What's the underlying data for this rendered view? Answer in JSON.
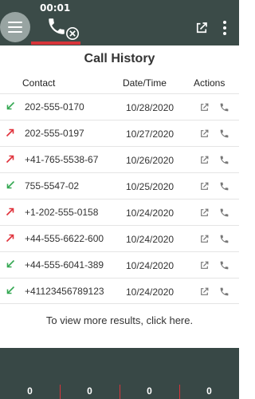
{
  "header": {
    "timer": "00:01",
    "colors": {
      "bar": "#3b4b48",
      "menu_circle": "#98a4a2",
      "active_underline": "#d8343a"
    }
  },
  "page": {
    "title": "Call History",
    "columns": {
      "contact": "Contact",
      "datetime": "Date/Time",
      "actions": "Actions"
    },
    "calls": [
      {
        "direction": "incoming",
        "number": "202-555-0170",
        "date": "10/28/2020"
      },
      {
        "direction": "outgoing",
        "number": "202-555-0197",
        "date": "10/27/2020"
      },
      {
        "direction": "outgoing",
        "number": "+41-765-5538-67",
        "date": "10/26/2020"
      },
      {
        "direction": "incoming",
        "number": "755-5547-02",
        "date": "10/25/2020"
      },
      {
        "direction": "outgoing",
        "number": "+1-202-555-0158",
        "date": "10/24/2020"
      },
      {
        "direction": "outgoing",
        "number": "+44-555-6622-600",
        "date": "10/24/2020"
      },
      {
        "direction": "incoming",
        "number": "+44-555-6041-389",
        "date": "10/24/2020"
      },
      {
        "direction": "incoming",
        "number": "+41123456789123",
        "date": "10/24/2020"
      }
    ],
    "more_results": "To view more results, click here.",
    "colors": {
      "incoming": "#35a853",
      "outgoing": "#e0323c"
    }
  },
  "footer": {
    "counters": [
      "0",
      "0",
      "0",
      "0"
    ]
  }
}
